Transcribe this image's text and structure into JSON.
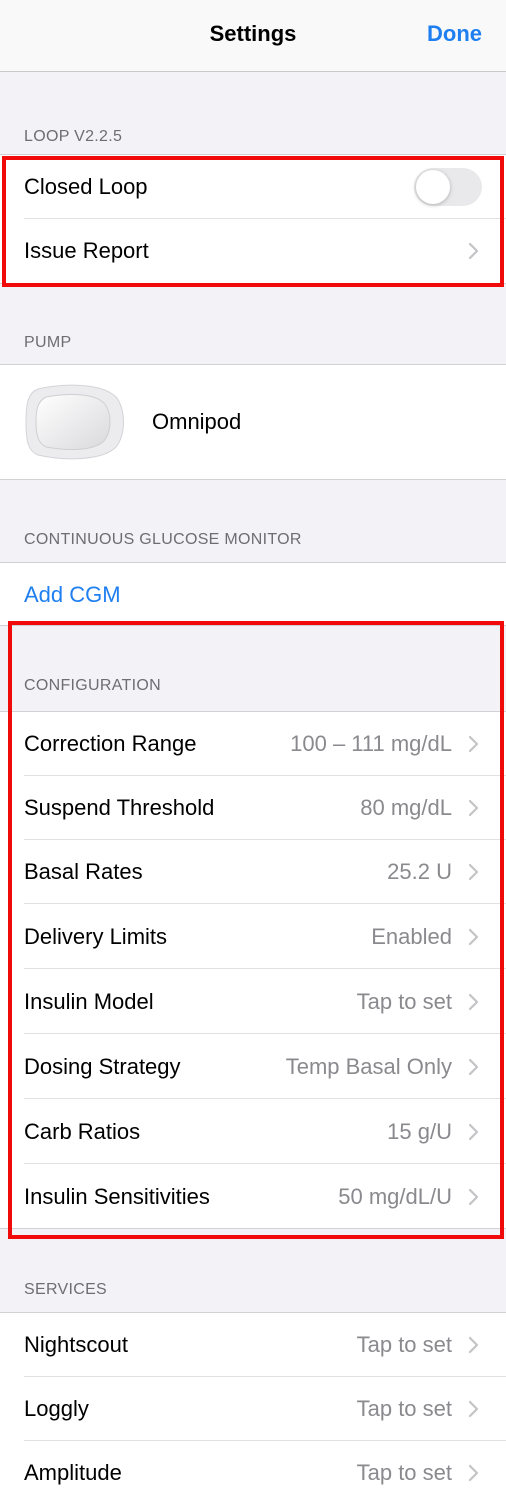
{
  "navbar": {
    "title": "Settings",
    "done_label": "Done"
  },
  "loop": {
    "header": "LOOP V2.2.5",
    "closed_loop_label": "Closed Loop",
    "closed_loop_on": false,
    "issue_report_label": "Issue Report"
  },
  "pump": {
    "header": "PUMP",
    "name": "Omnipod"
  },
  "cgm": {
    "header": "CONTINUOUS GLUCOSE MONITOR",
    "add_label": "Add CGM"
  },
  "configuration": {
    "header": "CONFIGURATION",
    "items": [
      {
        "label": "Correction Range",
        "value": "100 – 111 mg/dL"
      },
      {
        "label": "Suspend Threshold",
        "value": "80 mg/dL"
      },
      {
        "label": "Basal Rates",
        "value": "25.2 U"
      },
      {
        "label": "Delivery Limits",
        "value": "Enabled"
      },
      {
        "label": "Insulin Model",
        "value": "Tap to set"
      },
      {
        "label": "Dosing Strategy",
        "value": "Temp Basal Only"
      },
      {
        "label": "Carb Ratios",
        "value": "15 g/U"
      },
      {
        "label": "Insulin Sensitivities",
        "value": "50 mg/dL/U"
      }
    ]
  },
  "services": {
    "header": "SERVICES",
    "items": [
      {
        "label": "Nightscout",
        "value": "Tap to set"
      },
      {
        "label": "Loggly",
        "value": "Tap to set"
      },
      {
        "label": "Amplitude",
        "value": "Tap to set"
      }
    ]
  },
  "colors": {
    "accent": "#1f7ff0",
    "highlight": "#f00a0a",
    "secondary_text": "#8a8a8e"
  },
  "icons": {
    "chevron": "chevron-right-icon",
    "pump": "omnipod-pod-icon"
  }
}
